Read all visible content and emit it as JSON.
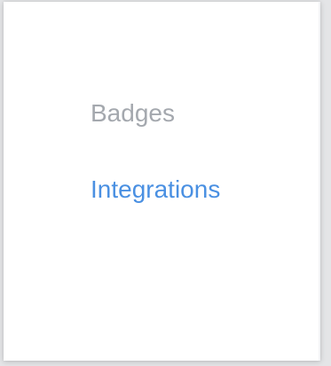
{
  "menu": {
    "items": [
      {
        "label": "Badges",
        "state": "inactive"
      },
      {
        "label": "Integrations",
        "state": "active"
      }
    ]
  },
  "colors": {
    "inactive_text": "#a4a8ae",
    "active_text": "#4a90e2",
    "panel_background": "#ffffff"
  }
}
